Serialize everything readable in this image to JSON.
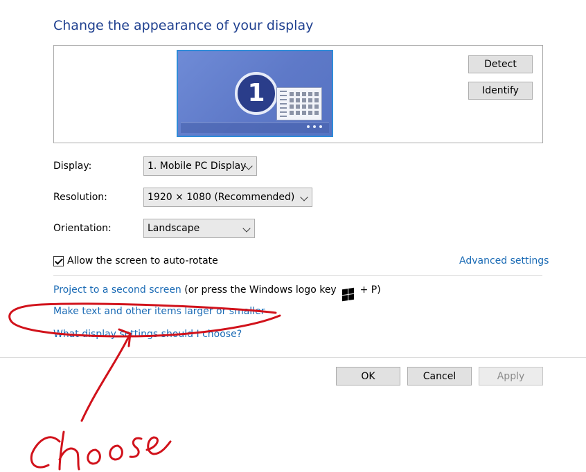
{
  "header": {
    "title": "Change the appearance of your display"
  },
  "preview": {
    "monitor_number": "1",
    "detect_label": "Detect",
    "identify_label": "Identify"
  },
  "settings": {
    "display_label": "Display:",
    "display_value": "1. Mobile PC Display",
    "resolution_label": "Resolution:",
    "resolution_value": "1920 × 1080 (Recommended)",
    "orientation_label": "Orientation:",
    "orientation_value": "Landscape",
    "autorotate_label": "Allow the screen to auto-rotate",
    "autorotate_checked": true,
    "advanced_link": "Advanced settings"
  },
  "links": {
    "project_link": "Project to a second screen",
    "project_hint_prefix": " (or press the Windows logo key",
    "project_hint_suffix": "+ P)",
    "text_size_link": "Make text and other items larger or smaller",
    "help_link": "What display settings should I choose?"
  },
  "footer": {
    "ok_label": "OK",
    "cancel_label": "Cancel",
    "apply_label": "Apply"
  },
  "annotation": {
    "handwritten_text": "Choose",
    "ink_color": "#d1121b"
  },
  "colors": {
    "title": "#1e3f8f",
    "link": "#1b6bb5"
  }
}
